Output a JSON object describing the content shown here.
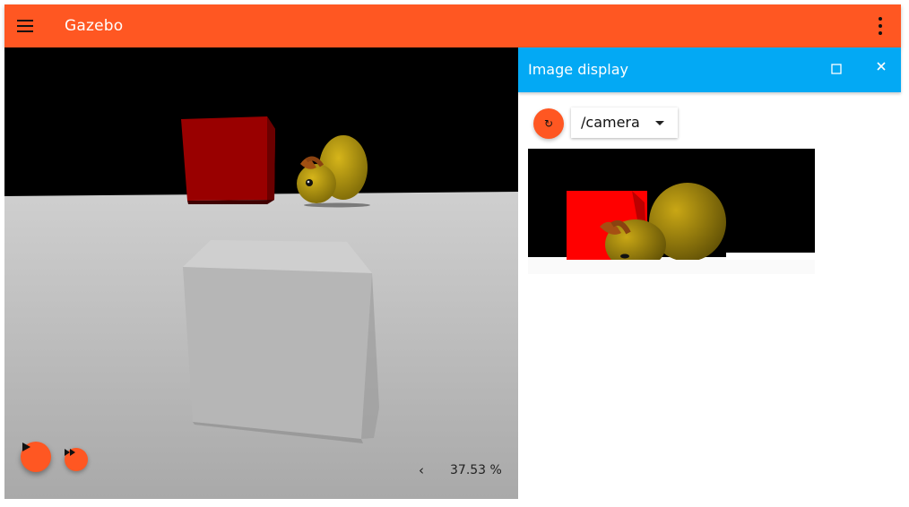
{
  "app": {
    "title": "Gazebo"
  },
  "scene": {
    "real_time_factor": "37.53 %"
  },
  "image_display": {
    "title": "Image display",
    "selected_topic": "/camera"
  },
  "colors": {
    "primary": "#ff5722",
    "panel_header": "#03a9f4"
  },
  "icons": {
    "menu": "hamburger-icon",
    "more": "more-vert-icon",
    "play": "play-icon",
    "step": "fast-forward-icon",
    "chevron": "chevron-left-icon",
    "maximize": "maximize-icon",
    "close": "close-icon",
    "refresh": "refresh-icon",
    "dropdown": "arrow-drop-down-icon"
  }
}
